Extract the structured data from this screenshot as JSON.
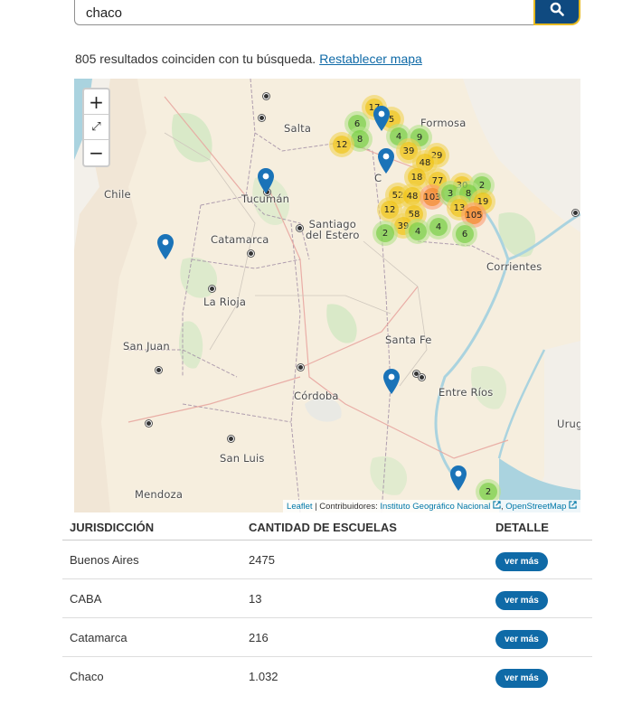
{
  "search": {
    "value": "chaco",
    "button_icon": "search-icon"
  },
  "results": {
    "text": "805 resultados coinciden con tu búsqueda.",
    "reset_link": "Restablecer mapa"
  },
  "map": {
    "zoom_in": "+",
    "fullscreen": "⤢",
    "zoom_out": "−",
    "attribution": {
      "leaflet": "Leaflet",
      "separator": " | Contribuidores: ",
      "ign": "Instituto Geográfico Nacional",
      "osm": "OpenStreetMap"
    },
    "places": {
      "chile": "Chile",
      "salta": "Salta",
      "formosa": "Formosa",
      "tucuman": "Tucumán",
      "santiago": "Santiago\ndel Estero",
      "catamarca": "Catamarca",
      "corrientes": "Corrientes",
      "larioja": "La Rioja",
      "sanjuan": "San Juan",
      "santafe": "Santa Fe",
      "entrerios": "Entre Ríos",
      "cordoba": "Córdoba",
      "sanluis": "San Luis",
      "mendoza": "Mendoza",
      "urug": "Urug",
      "c": "C"
    },
    "clusters": [
      "17",
      "5",
      "6",
      "4",
      "9",
      "8",
      "12",
      "39",
      "29",
      "48",
      "18",
      "77",
      "30",
      "2",
      "52",
      "48",
      "103",
      "3",
      "8",
      "19",
      "12",
      "58",
      "13",
      "105",
      "39",
      "2",
      "4",
      "4",
      "6",
      "2"
    ]
  },
  "table": {
    "headers": [
      "JURISDICCIÓN",
      "CANTIDAD DE ESCUELAS",
      "DETALLE"
    ],
    "button_label": "ver más",
    "rows": [
      {
        "name": "Buenos Aires",
        "count": "2475"
      },
      {
        "name": "CABA",
        "count": "13"
      },
      {
        "name": "Catamarca",
        "count": "216"
      },
      {
        "name": "Chaco",
        "count": "1.032"
      }
    ]
  }
}
